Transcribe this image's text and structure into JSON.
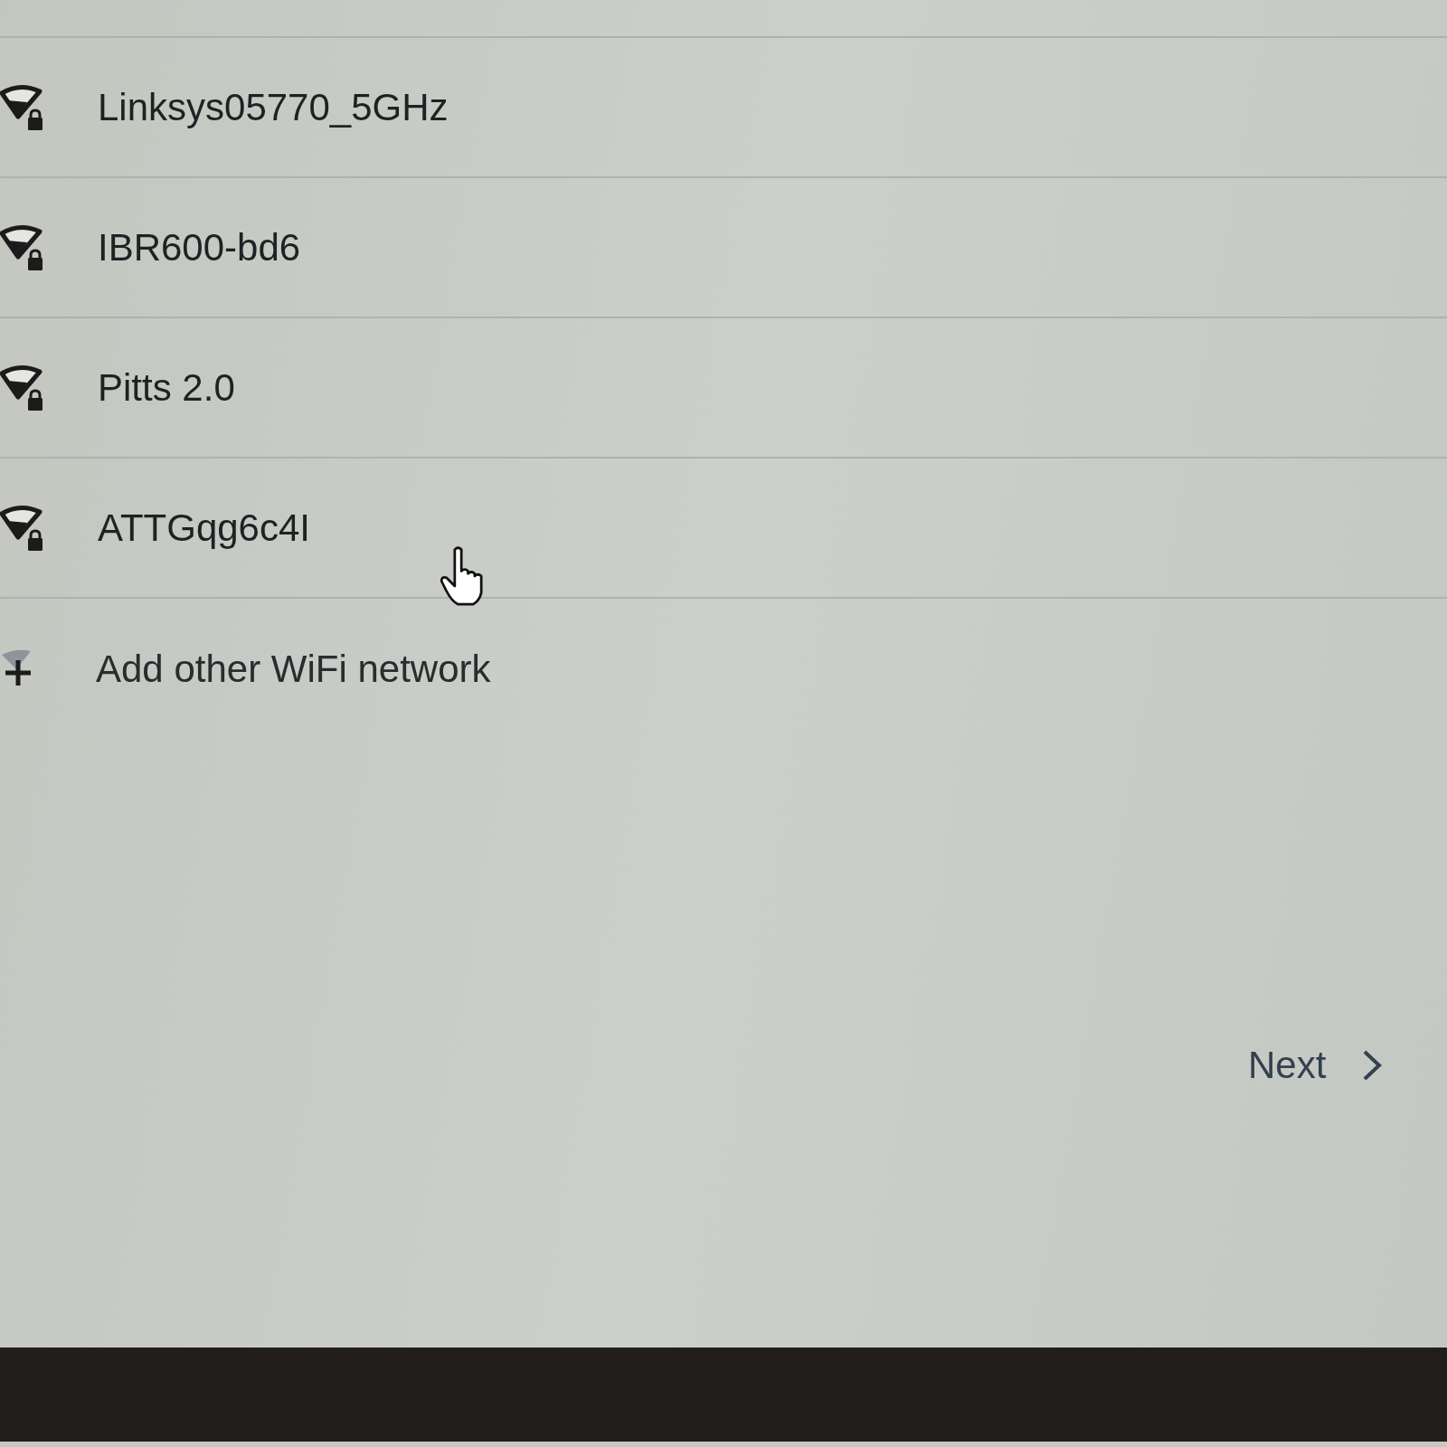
{
  "networks": [
    {
      "name": "Linksys05770_5GHz",
      "secured": true
    },
    {
      "name": "IBR600-bd6",
      "secured": true
    },
    {
      "name": "Pitts 2.0",
      "secured": true
    },
    {
      "name": "ATTGqg6c4I",
      "secured": true
    }
  ],
  "add_network": {
    "label": "Add other WiFi network"
  },
  "next_button": {
    "label": "Next"
  }
}
